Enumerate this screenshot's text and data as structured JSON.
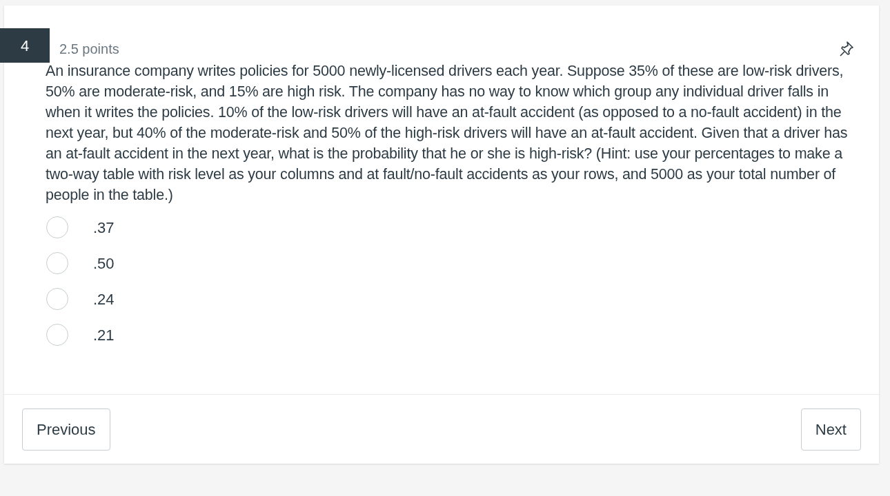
{
  "question": {
    "number": "4",
    "points": "2.5 points",
    "pinned": false,
    "text": "An insurance company writes policies for 5000 newly-licensed drivers each year. Suppose 35% of these are low-risk drivers, 50% are moderate-risk, and 15% are high risk.  The company has no way to know which group any individual driver falls in when it writes the policies. 10% of the low-risk drivers will have an at-fault accident (as opposed to a no-fault accident) in the next year, but 40% of the moderate-risk and 50% of the high-risk drivers will have an at-fault accident.  Given that a driver has an at-fault accident in the next year, what is the probability that he or she is high-risk? (Hint: use your percentages to make a two-way table with risk level as your columns and at fault/no-fault accidents as your rows, and 5000 as your total number of people in the table.)"
  },
  "answers": [
    {
      "label": ".37",
      "selected": false
    },
    {
      "label": ".50",
      "selected": false
    },
    {
      "label": ".24",
      "selected": false
    },
    {
      "label": ".21",
      "selected": false
    }
  ],
  "buttons": {
    "previous": "Previous",
    "next": "Next"
  }
}
